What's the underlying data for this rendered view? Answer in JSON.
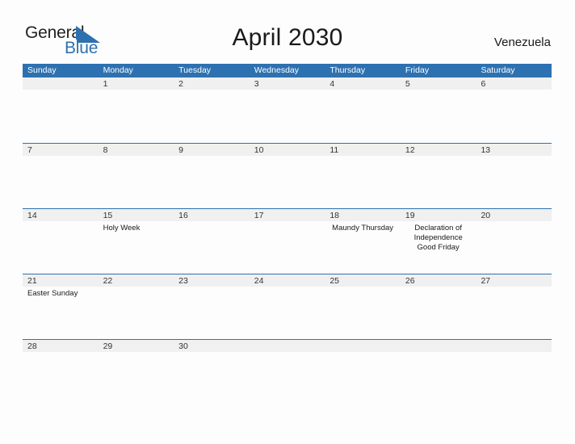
{
  "brand": {
    "word_one": "General",
    "word_two": "Blue",
    "flag_icon": "blue-triangle-flag",
    "accent_color": "#2E71B0"
  },
  "header": {
    "title": "April 2030",
    "region": "Venezuela"
  },
  "calendar": {
    "header_background": "#2E71B0",
    "date_band_background": "#F0F0F0",
    "weekdays": [
      "Sunday",
      "Monday",
      "Tuesday",
      "Wednesday",
      "Thursday",
      "Friday",
      "Saturday"
    ],
    "weeks": [
      [
        {
          "date": "",
          "events": []
        },
        {
          "date": "1",
          "events": []
        },
        {
          "date": "2",
          "events": []
        },
        {
          "date": "3",
          "events": []
        },
        {
          "date": "4",
          "events": []
        },
        {
          "date": "5",
          "events": []
        },
        {
          "date": "6",
          "events": []
        }
      ],
      [
        {
          "date": "7",
          "events": []
        },
        {
          "date": "8",
          "events": []
        },
        {
          "date": "9",
          "events": []
        },
        {
          "date": "10",
          "events": []
        },
        {
          "date": "11",
          "events": []
        },
        {
          "date": "12",
          "events": []
        },
        {
          "date": "13",
          "events": []
        }
      ],
      [
        {
          "date": "14",
          "events": []
        },
        {
          "date": "15",
          "events": [
            "Holy Week"
          ],
          "align": "left"
        },
        {
          "date": "16",
          "events": []
        },
        {
          "date": "17",
          "events": []
        },
        {
          "date": "18",
          "events": [
            "Maundy Thursday"
          ]
        },
        {
          "date": "19",
          "events": [
            "Declaration of Independence",
            "Good Friday"
          ]
        },
        {
          "date": "20",
          "events": []
        }
      ],
      [
        {
          "date": "21",
          "events": [
            "Easter Sunday"
          ],
          "align": "left"
        },
        {
          "date": "22",
          "events": []
        },
        {
          "date": "23",
          "events": []
        },
        {
          "date": "24",
          "events": []
        },
        {
          "date": "25",
          "events": []
        },
        {
          "date": "26",
          "events": []
        },
        {
          "date": "27",
          "events": []
        }
      ],
      [
        {
          "date": "28",
          "events": []
        },
        {
          "date": "29",
          "events": []
        },
        {
          "date": "30",
          "events": []
        },
        {
          "date": "",
          "events": []
        },
        {
          "date": "",
          "events": []
        },
        {
          "date": "",
          "events": []
        },
        {
          "date": "",
          "events": []
        }
      ]
    ]
  }
}
